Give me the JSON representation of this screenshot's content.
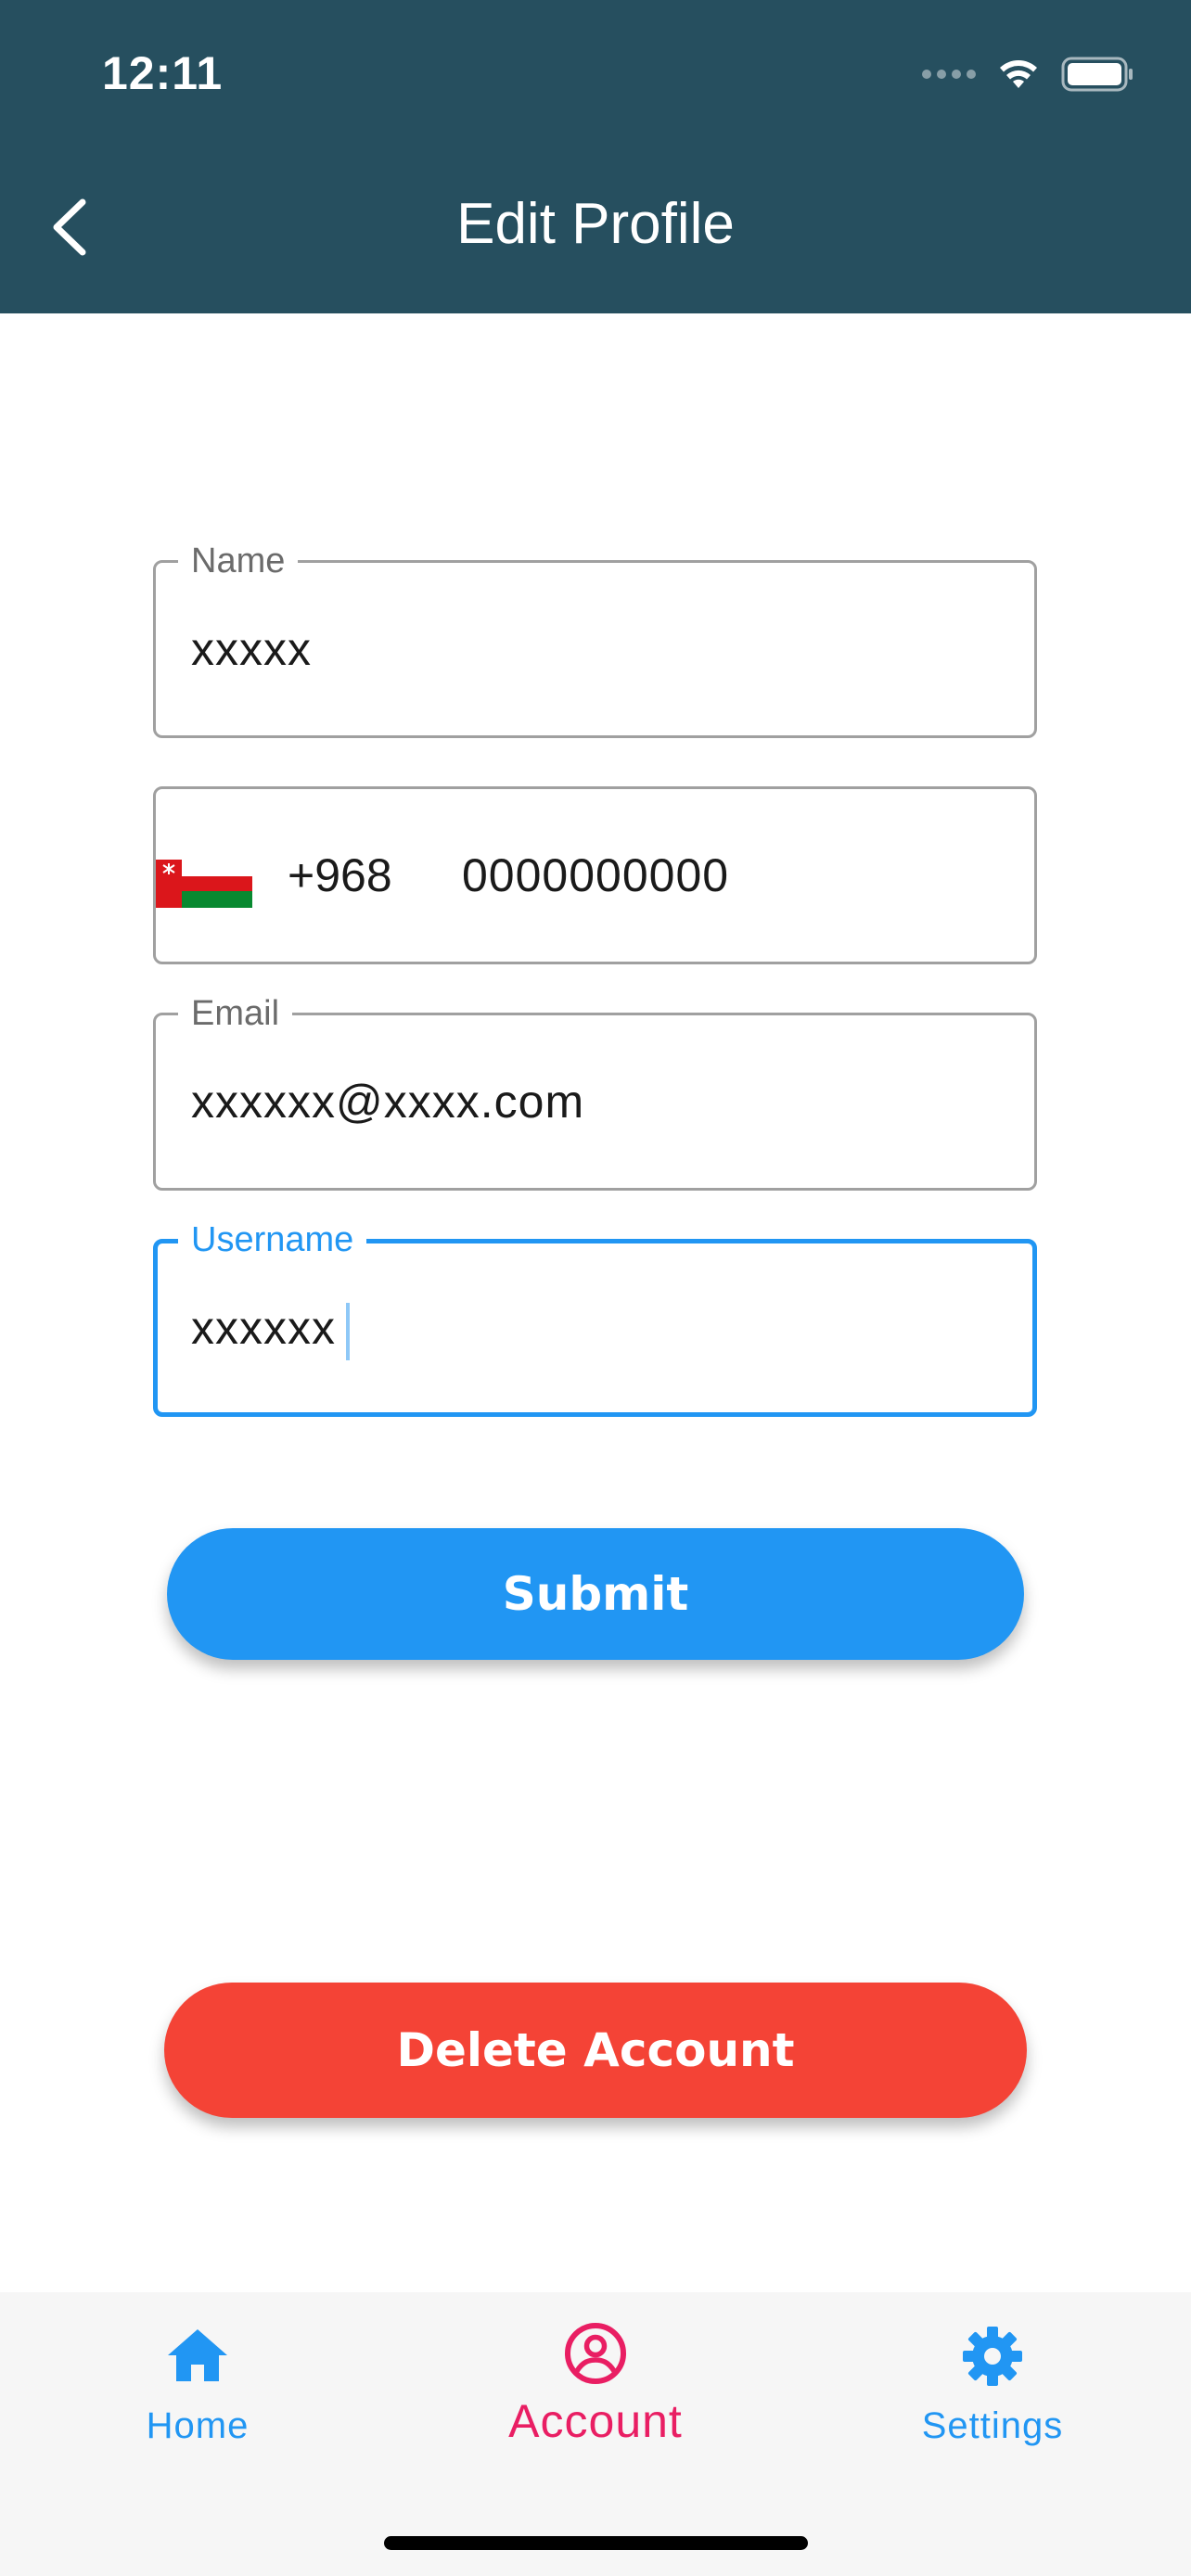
{
  "status_bar": {
    "time": "12:11"
  },
  "header": {
    "title": "Edit Profile",
    "back_icon": "chevron-left-icon"
  },
  "form": {
    "name": {
      "label": "Name",
      "value": "xxxxx"
    },
    "phone": {
      "country_flag": "oman-flag",
      "dial_code": "+968",
      "value": "0000000000"
    },
    "email": {
      "label": "Email",
      "value": "xxxxxx@xxxx.com"
    },
    "username": {
      "label": "Username",
      "value": "xxxxxx",
      "focused": true
    }
  },
  "actions": {
    "submit_label": "Submit",
    "delete_label": "Delete Account"
  },
  "bottom_nav": {
    "items": [
      {
        "label": "Home",
        "icon": "home-icon",
        "active": false
      },
      {
        "label": "Account",
        "icon": "account-circle-icon",
        "active": true
      },
      {
        "label": "Settings",
        "icon": "gear-icon",
        "active": false
      }
    ]
  },
  "colors": {
    "header_bg": "#264f5f",
    "primary": "#2196f3",
    "danger": "#f44336",
    "active_nav": "#e91e63"
  }
}
